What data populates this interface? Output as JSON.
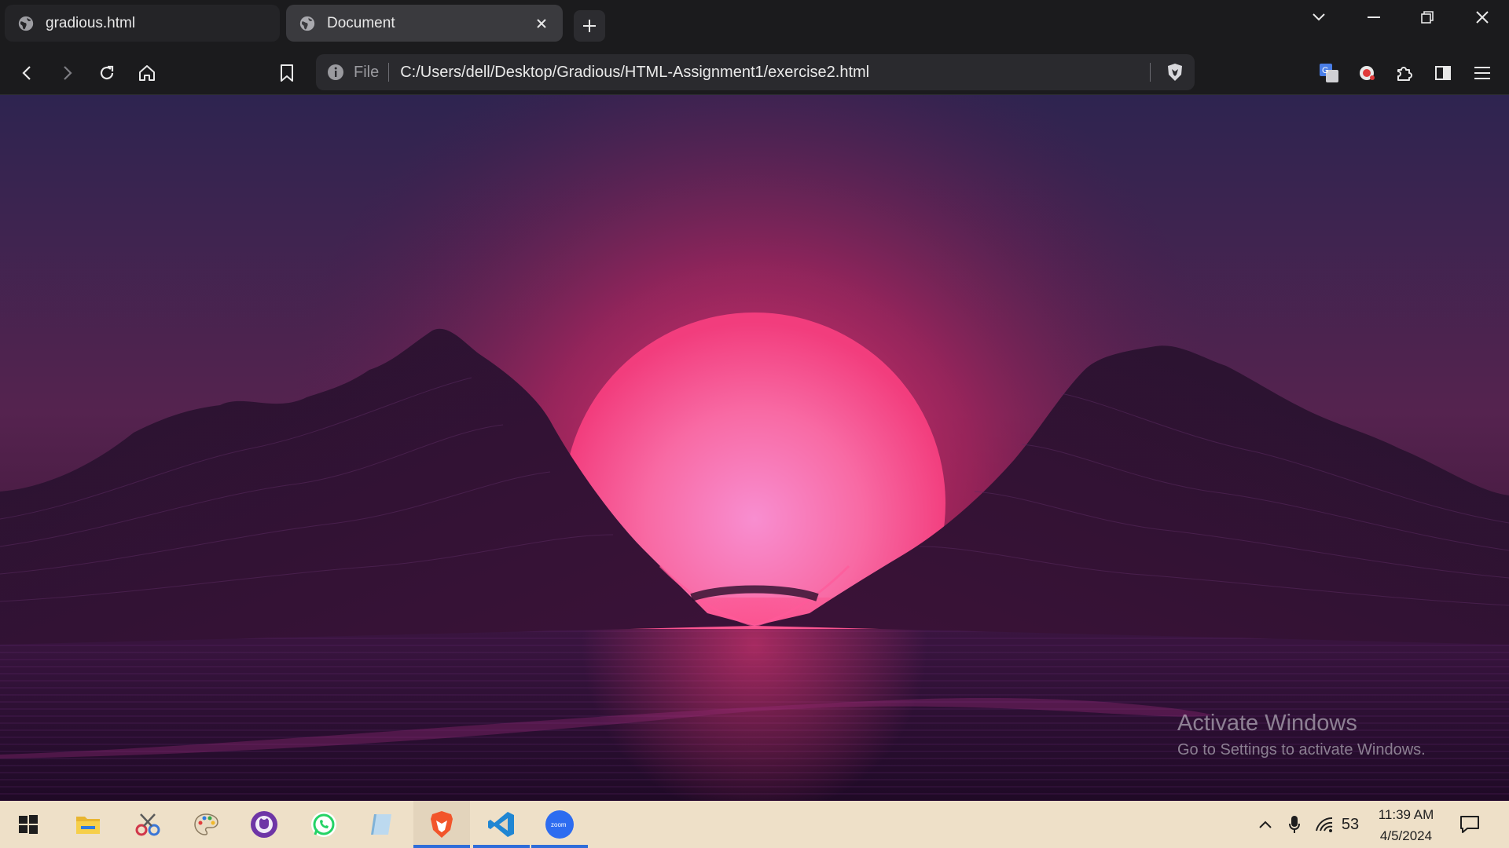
{
  "tabs": [
    {
      "title": "gradious.html",
      "active": false
    },
    {
      "title": "Document",
      "active": true
    }
  ],
  "toolbar": {
    "scheme": "File",
    "url": "C:/Users/dell/Desktop/Gradious/HTML-Assignment1/exercise2.html"
  },
  "page": {
    "image": "synthwave-sunset-mountains",
    "colors": {
      "sky_top": "#2e2450",
      "sun": "#f7679e",
      "mountains": "#2c0f2e",
      "ground": "#321238"
    }
  },
  "watermark": {
    "title": "Activate Windows",
    "subtitle": "Go to Settings to activate Windows."
  },
  "taskbar": {
    "apps": [
      "windows-start",
      "file-explorer",
      "snipping-tool",
      "paint",
      "github-desktop",
      "whatsapp",
      "notepad",
      "brave-browser",
      "vscode",
      "zoom"
    ],
    "tray": {
      "battery": "53",
      "time": "11:39 AM",
      "date": "4/5/2024"
    }
  }
}
